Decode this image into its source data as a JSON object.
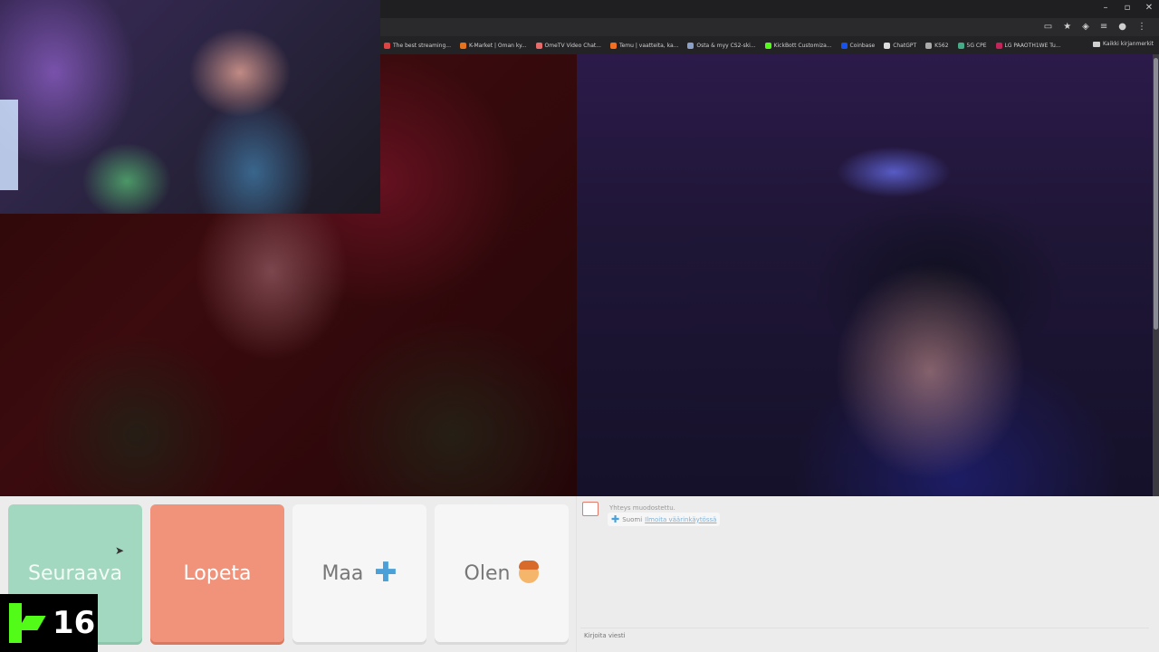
{
  "browser": {
    "bookmarks": [
      {
        "label": "The best streaming...",
        "color": "#d44"
      },
      {
        "label": "K-Market | Oman ky...",
        "color": "#e8731d"
      },
      {
        "label": "OmeTV Video Chat...",
        "color": "#e86b6b"
      },
      {
        "label": "Temu | vaatteita, ka...",
        "color": "#f37021"
      },
      {
        "label": "Osta & myy CS2-ski...",
        "color": "#8aa0c8"
      },
      {
        "label": "KickBott Customiza...",
        "color": "#53fc18"
      },
      {
        "label": "Coinbase",
        "color": "#1652f0"
      },
      {
        "label": "ChatGPT",
        "color": "#dddddd"
      },
      {
        "label": "K562",
        "color": "#aaaaaa"
      },
      {
        "label": "5G CPE",
        "color": "#4a8"
      },
      {
        "label": "LG PAAOTH1WE Tu...",
        "color": "#c3245a"
      }
    ],
    "bookmarks_folder": "Kaikki kirjanmerkit"
  },
  "controls": {
    "next_label": "Seuraava",
    "stop_label": "Lopeta",
    "country_label": "Maa",
    "gender_label": "Olen"
  },
  "chat": {
    "status": "Yhteys muodostettu.",
    "country_name": "Suomi",
    "country_link": "Ilmoita väärinkäytössä",
    "input_placeholder": "Kirjoita viesti"
  },
  "badge": {
    "number": "16"
  },
  "colors": {
    "next_button": "#a2d8c0",
    "stop_button": "#f0937a",
    "kick_green": "#53fc18"
  }
}
